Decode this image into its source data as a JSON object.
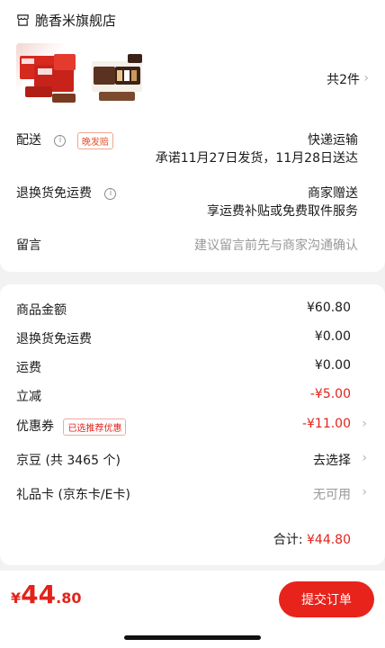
{
  "shop": {
    "name": "脆香米旗舰店"
  },
  "products": {
    "count_label": "共2件"
  },
  "delivery": {
    "label": "配送",
    "tag": "晚发赔",
    "method": "快递运输",
    "promise": "承诺11月27日发货，11月28日送达"
  },
  "returns": {
    "label": "退换货免运费",
    "value": "商家赠送",
    "desc": "享运费补贴或免费取件服务"
  },
  "message": {
    "label": "留言",
    "placeholder": "建议留言前先与商家沟通确认"
  },
  "summary": {
    "goods_label": "商品金额",
    "goods_value": "¥60.80",
    "returns_label": "退换货免运费",
    "returns_value": "¥0.00",
    "shipping_label": "运费",
    "shipping_value": "¥0.00",
    "discount_label": "立减",
    "discount_value": "-¥5.00",
    "coupon_label": "优惠券",
    "coupon_tag": "已选推荐优惠",
    "coupon_value": "-¥11.00",
    "jd_beans_label": "京豆 (共 3465 个)",
    "jd_beans_value": "去选择",
    "gift_card_label": "礼品卡 (京东卡/E卡)",
    "gift_card_value": "无可用",
    "total_label": "合计:",
    "total_value": "¥44.80"
  },
  "bottom": {
    "price_symbol": "¥",
    "price_int": "44",
    "price_dec": ".80",
    "submit_label": "提交订单"
  },
  "colors": {
    "accent_red": "#e2231a",
    "muted": "#999999",
    "background": "#f2f2f2"
  }
}
